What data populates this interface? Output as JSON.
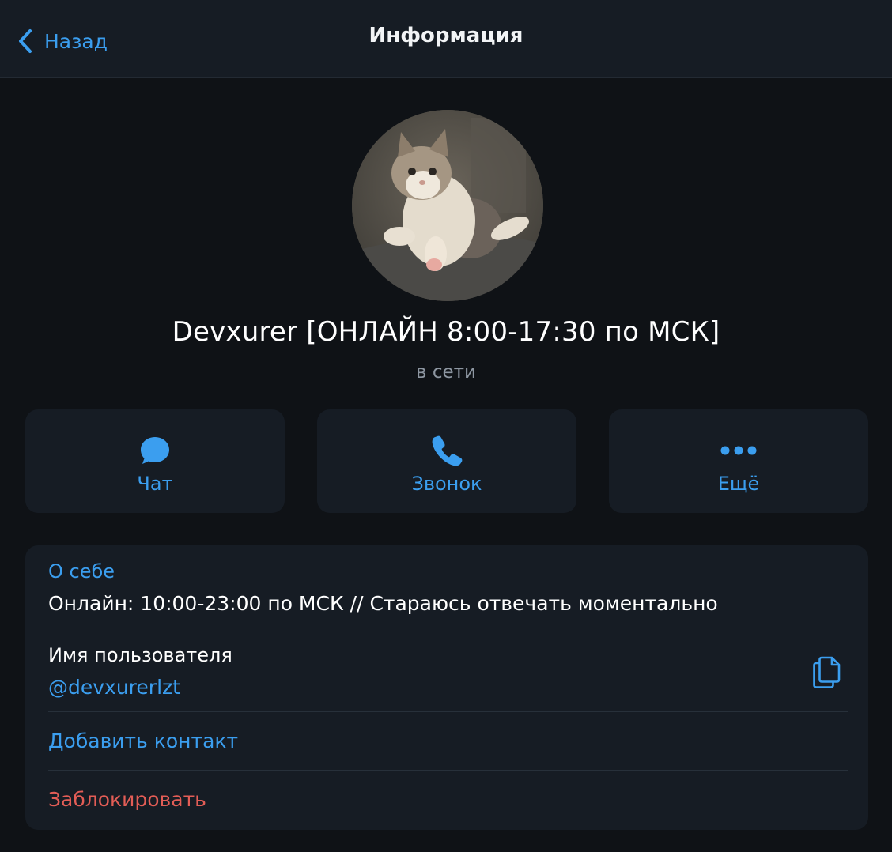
{
  "header": {
    "back_label": "Назад",
    "title": "Информация"
  },
  "profile": {
    "name": "Devxurer [ОНЛАЙН 8:00-17:30 по МСК]",
    "status": "в сети"
  },
  "actions": [
    {
      "label": "Чат",
      "icon": "chat-bubble-icon"
    },
    {
      "label": "Звонок",
      "icon": "phone-icon"
    },
    {
      "label": "Ещё",
      "icon": "more-dots-icon"
    }
  ],
  "info": {
    "about_label": "О себе",
    "about_text": "Онлайн: 10:00-23:00 по МСК // Стараюсь отвечать моментально",
    "username_label": "Имя пользователя",
    "username_value": "@devxurerlzt",
    "copy_icon": "copy-icon",
    "add_contact_label": "Добавить контакт",
    "block_label": "Заблокировать"
  },
  "colors": {
    "accent": "#3b9eef",
    "danger": "#e35d56",
    "background": "#0f1216",
    "surface": "#161c24",
    "secondary_text": "#8d96a1"
  }
}
